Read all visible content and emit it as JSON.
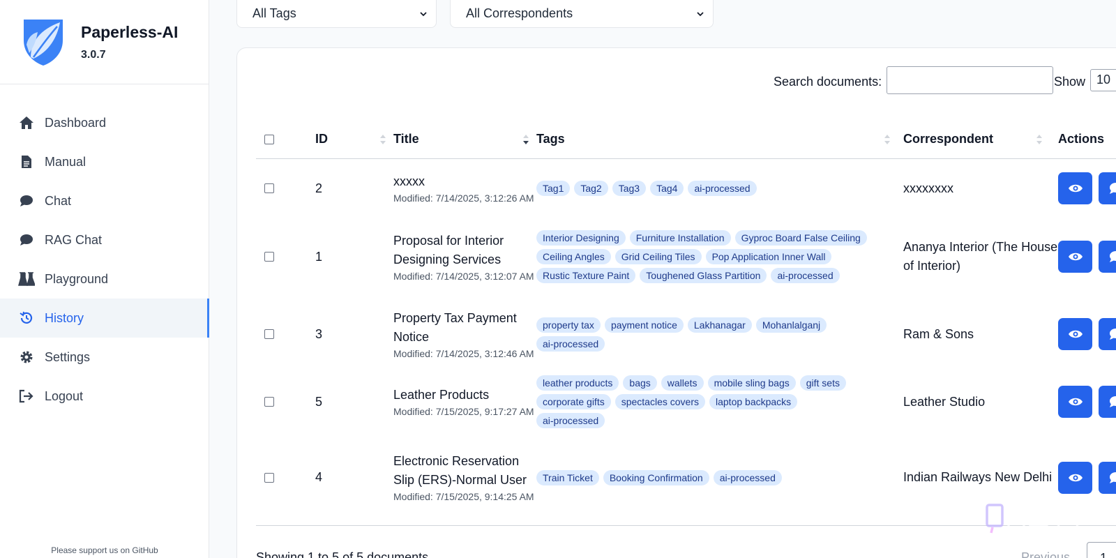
{
  "app": {
    "name": "Paperless-AI",
    "version": "3.0.7"
  },
  "sidebar": {
    "items": [
      {
        "label": "Dashboard",
        "icon": "home-icon"
      },
      {
        "label": "Manual",
        "icon": "document-icon"
      },
      {
        "label": "Chat",
        "icon": "chat-bubble-icon"
      },
      {
        "label": "RAG Chat",
        "icon": "chat-bubble-icon"
      },
      {
        "label": "Playground",
        "icon": "flask-icon"
      },
      {
        "label": "History",
        "icon": "history-icon",
        "active": true
      },
      {
        "label": "Settings",
        "icon": "gear-icon"
      },
      {
        "label": "Logout",
        "icon": "logout-icon"
      }
    ],
    "footer": "Please support us on GitHub"
  },
  "filters": {
    "tags": "All Tags",
    "correspondents": "All Correspondents"
  },
  "search": {
    "label": "Search documents:",
    "value": ""
  },
  "show": {
    "label": "Show",
    "value": "10"
  },
  "table": {
    "headers": {
      "id": "ID",
      "title": "Title",
      "tags": "Tags",
      "correspondent": "Correspondent",
      "actions": "Actions"
    },
    "rows": [
      {
        "id": "2",
        "title": "xxxxx",
        "modified": "Modified: 7/14/2025, 3:12:26 AM",
        "tags": [
          "Tag1",
          "Tag2",
          "Tag3",
          "Tag4",
          "ai-processed"
        ],
        "correspondent": "xxxxxxxx"
      },
      {
        "id": "1",
        "title": "Proposal for Interior Designing Services",
        "modified": "Modified: 7/14/2025, 3:12:07 AM",
        "tags": [
          "Interior Designing",
          "Furniture Installation",
          "Gyproc Board False Ceiling",
          "Ceiling Angles",
          "Grid Ceiling Tiles",
          "Pop Application Inner Wall",
          "Rustic Texture Paint",
          "Toughened Glass Partition",
          "ai-processed"
        ],
        "correspondent": "Ananya Interior (The House of Interior)"
      },
      {
        "id": "3",
        "title": "Property Tax Payment Notice",
        "modified": "Modified: 7/14/2025, 3:12:46 AM",
        "tags": [
          "property tax",
          "payment notice",
          "Lakhanagar",
          "Mohanlalganj",
          "ai-processed"
        ],
        "correspondent": "Ram & Sons"
      },
      {
        "id": "5",
        "title": "Leather Products",
        "modified": "Modified: 7/15/2025, 9:17:27 AM",
        "tags": [
          "leather products",
          "bags",
          "wallets",
          "mobile sling bags",
          "gift sets",
          "corporate gifts",
          "spectacles covers",
          "laptop backpacks",
          "ai-processed"
        ],
        "correspondent": "Leather Studio"
      },
      {
        "id": "4",
        "title": "Electronic Reservation Slip (ERS)-Normal User",
        "modified": "Modified: 7/15/2025, 9:14:25 AM",
        "tags": [
          "Train Ticket",
          "Booking Confirmation",
          "ai-processed"
        ],
        "correspondent": "Indian Railways New Delhi"
      }
    ]
  },
  "pagination": {
    "info": "Showing 1 to 5 of 5 documents",
    "previous": "Previous",
    "page": "1"
  },
  "colors": {
    "accent": "#2563eb",
    "tag_bg": "#dbeafe",
    "tag_text": "#1e3a8a"
  }
}
